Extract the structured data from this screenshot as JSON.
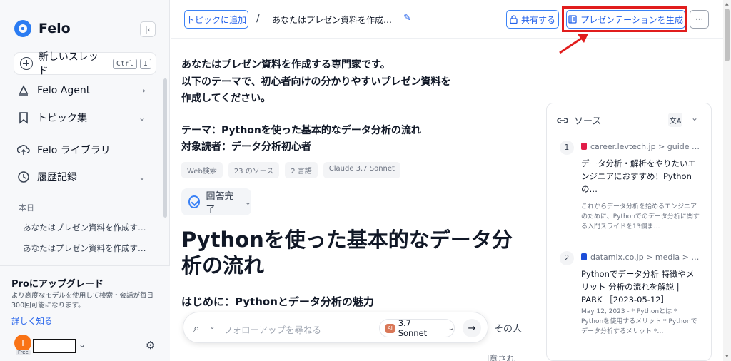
{
  "sidebar": {
    "logo": "Felo",
    "collapse_icon": "collapse-sidebar-icon",
    "new_thread": {
      "label": "新しいスレッド",
      "kbd": [
        "Ctrl",
        "I"
      ]
    },
    "nav": [
      {
        "label": "Felo Agent",
        "icon": "agent-icon",
        "chevron": "›"
      },
      {
        "label": "トピック集",
        "icon": "bookmark-icon",
        "chevron": "⌄"
      },
      {
        "label": "Felo ライブラリ",
        "icon": "cloud-upload-icon"
      },
      {
        "label": "履歴記録",
        "icon": "history-icon",
        "chevron": "⌄"
      }
    ],
    "history_section": "本日",
    "history": [
      "あなたはプレゼン資料を作成す…",
      "あなたはプレゼン資料を作成す…"
    ],
    "upgrade": {
      "title": "Proにアップグレード",
      "desc": "より高度なモデルを使用して検索・会話が毎日300回可能になります。",
      "link": "詳しく知る"
    },
    "user": {
      "avatar_initial": "I",
      "plan": "Free",
      "avatar_color": "#f97316"
    }
  },
  "topbar": {
    "add_topic": "トピックに追加",
    "slash": "/",
    "title": "あなたはプレゼン資料を作成す…",
    "share": "共有する",
    "generate_presentation": "プレゼンテーションを生成",
    "more": "···"
  },
  "main": {
    "prompt_lines": [
      "あなたはプレゼン資料を作成する専門家です。",
      "以下のテーマで、初心者向けの分かりやすいプレゼン資料を",
      "作成してください。",
      "",
      "テーマ：Pythonを使った基本的なデータ分析の流れ",
      "対象読者：データ分析初心者"
    ],
    "tags": [
      "Web検索",
      "23 のソース",
      "2 言語",
      "Claude 3.7 Sonnet"
    ],
    "status": "回答完了",
    "heading": "Pythonを使った基本的なデータ分析の流れ",
    "subheading": "はじめに：Pythonとデータ分析の魅力",
    "truncated_right": "その人",
    "truncated_bottom": "l意され"
  },
  "followup": {
    "placeholder": "フォローアップを尋ねる",
    "model": "3.7 Sonnet",
    "model_badge": "AI"
  },
  "sources": {
    "title": "ソース",
    "translate": "文A",
    "items": [
      {
        "num": "1",
        "site": "career.levtech.jp > guide …",
        "fav_color": "#e11d48",
        "title": "データ分析・解析をやりたいエンジニアにおすすめ！Pythonの…",
        "snippet": "これからデータ分析を始めるエンジニアのために、Pythonでのデータ分析に関する入門スライドを13個ま…"
      },
      {
        "num": "2",
        "site": "datamix.co.jp > media > d…",
        "fav_color": "#1d4ed8",
        "title": "Pythonでデータ分析 特徴やメリット 分析の流れを解説 | PARK ［2023-05-12］",
        "snippet": "May 12, 2023 - * Pythonとは * Pythonを使用するメリット * Pythonでデータ分析するメリット *…"
      }
    ]
  },
  "colors": {
    "accent": "#2563eb",
    "highlight": "#e11d1d",
    "sidebar_bg": "#f7f8fa"
  }
}
